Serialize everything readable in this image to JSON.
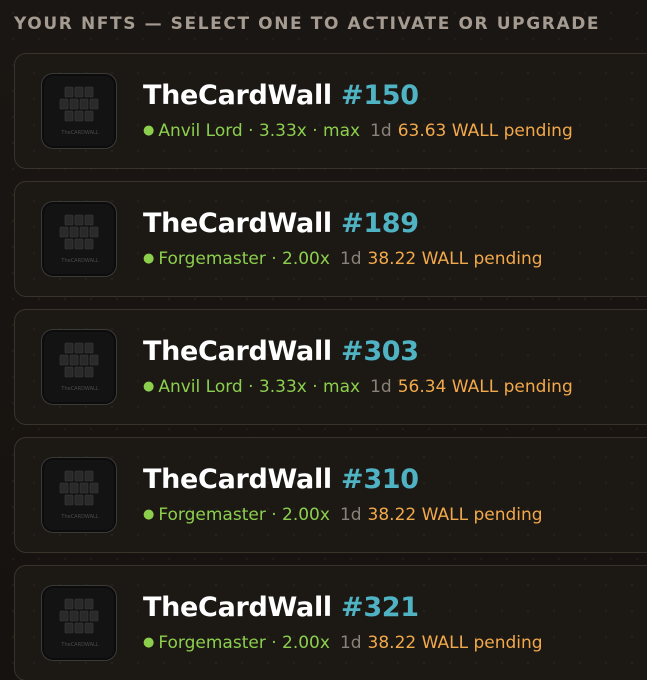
{
  "heading": "YOUR NFTS — SELECT ONE TO ACTIVATE OR UPGRADE",
  "thumb_logo_text": "TheCARDWALL",
  "nfts": [
    {
      "collection": "TheCardWall",
      "number": "#150",
      "tier_line": "Anvil Lord · 3.33x · max",
      "age": "1d",
      "pending": "63.63 WALL pending"
    },
    {
      "collection": "TheCardWall",
      "number": "#189",
      "tier_line": "Forgemaster · 2.00x",
      "age": "1d",
      "pending": "38.22 WALL pending"
    },
    {
      "collection": "TheCardWall",
      "number": "#303",
      "tier_line": "Anvil Lord · 3.33x · max",
      "age": "1d",
      "pending": "56.34 WALL pending"
    },
    {
      "collection": "TheCardWall",
      "number": "#310",
      "tier_line": "Forgemaster · 2.00x",
      "age": "1d",
      "pending": "38.22 WALL pending"
    },
    {
      "collection": "TheCardWall",
      "number": "#321",
      "tier_line": "Forgemaster · 2.00x",
      "age": "1d",
      "pending": "38.22 WALL pending"
    }
  ],
  "colors": {
    "accent_number": "#4fb3c4",
    "tier_green": "#8ccf4d",
    "pending_orange": "#f2a94b"
  },
  "icons": {
    "status": "active-dot-icon",
    "thumbnail": "cardwall-logo-icon"
  }
}
